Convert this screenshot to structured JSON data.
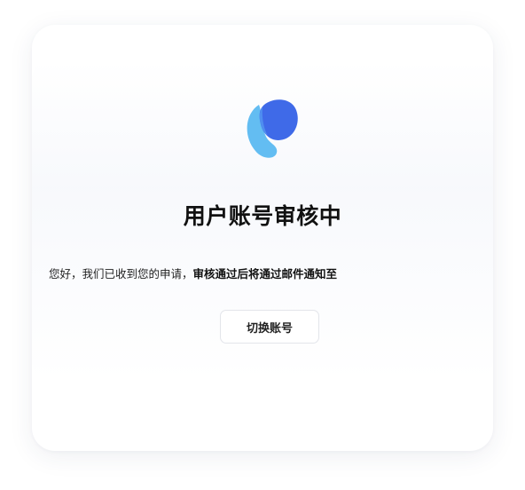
{
  "card": {
    "icon": "app-logo",
    "title": "用户账号审核中",
    "message_normal": "您好，我们已收到您的申请，",
    "message_bold": "审核通过后将通过邮件通知至",
    "switch_button_label": "切换账号"
  },
  "colors": {
    "logo_primary": "#3f6ae8",
    "logo_secondary": "#63bdf2",
    "title_text": "#111111",
    "button_border": "#e3e5ea"
  }
}
